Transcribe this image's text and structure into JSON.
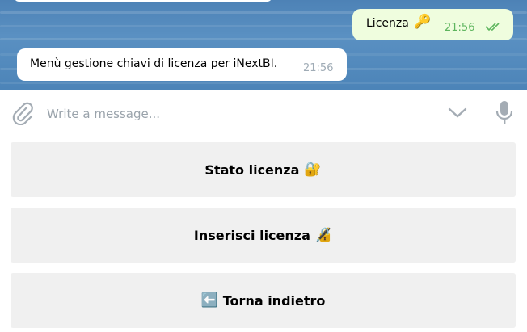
{
  "messages": {
    "outgoing": {
      "text": "Licenza",
      "emoji": "🔑",
      "time": "21:56"
    },
    "incoming": {
      "text": "Menù gestione chiavi di licenza per iNextBI.",
      "time": "21:56"
    }
  },
  "composer": {
    "placeholder": "Write a message...",
    "icons": {
      "attach": "paperclip-icon",
      "expand": "chevron-down-icon",
      "voice": "microphone-icon"
    }
  },
  "keyboard": {
    "buttons": [
      {
        "label": "Stato licenza",
        "emoji": "🔐",
        "emoji_first": false
      },
      {
        "label": "Inserisci licenza",
        "emoji": "🔏",
        "emoji_first": false
      },
      {
        "label": "Torna indietro",
        "emoji": "⬅️",
        "emoji_first": true
      }
    ]
  },
  "colors": {
    "outgoing_bubble": "#effdde",
    "outgoing_time": "#5eb55e",
    "incoming_time": "#a0acb6",
    "chat_background": "#4d82b6",
    "keyboard_button": "#f0f0f0"
  }
}
